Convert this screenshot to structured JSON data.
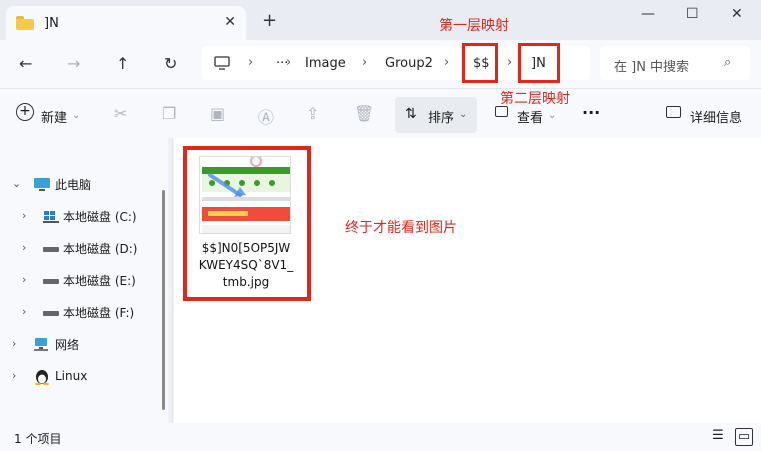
{
  "tab": {
    "title": "]N",
    "close": "✕"
  },
  "window": {
    "new_tab": "+",
    "minimize": "—",
    "maximize": "☐",
    "close": "✕"
  },
  "annotations": {
    "first_layer": "第一层映射",
    "second_layer": "第二层映射",
    "finally": "终于才能看到图片"
  },
  "address": {
    "computer_icon": "monitor-icon",
    "more": "···",
    "crumbs": [
      "Image",
      "Group2",
      "$$",
      "]N"
    ],
    "separator": "›"
  },
  "search": {
    "placeholder": "在 ]N 中搜索",
    "icon": "⌕"
  },
  "nav_buttons": {
    "back": "←",
    "forward": "→",
    "up": "↑",
    "refresh": "↻"
  },
  "toolbar": {
    "new": "新建",
    "sort": "排序",
    "view": "查看",
    "more": "···",
    "details": "详细信息"
  },
  "sidebar": {
    "items": [
      {
        "label": "此电脑",
        "icon": "pc-icon"
      },
      {
        "label": "本地磁盘 (C:)",
        "icon": "windows-drive-icon"
      },
      {
        "label": "本地磁盘 (D:)",
        "icon": "drive-icon"
      },
      {
        "label": "本地磁盘 (E:)",
        "icon": "drive-icon"
      },
      {
        "label": "本地磁盘 (F:)",
        "icon": "drive-icon"
      },
      {
        "label": "网络",
        "icon": "network-icon"
      },
      {
        "label": "Linux",
        "icon": "linux-icon"
      }
    ]
  },
  "file": {
    "name": "$$]N0[5OP5JW KWEY4SQ`8V1_ tmb.jpg",
    "name_lines": [
      "$$]N0[5OP5JW",
      "KWEY4SQ`8V1_",
      "tmb.jpg"
    ]
  },
  "status": {
    "count": "1 个项目"
  },
  "colors": {
    "annotation_red": "#e1261c",
    "folder_yellow": "#f6c94a",
    "accent_blue": "#1a73c8"
  }
}
